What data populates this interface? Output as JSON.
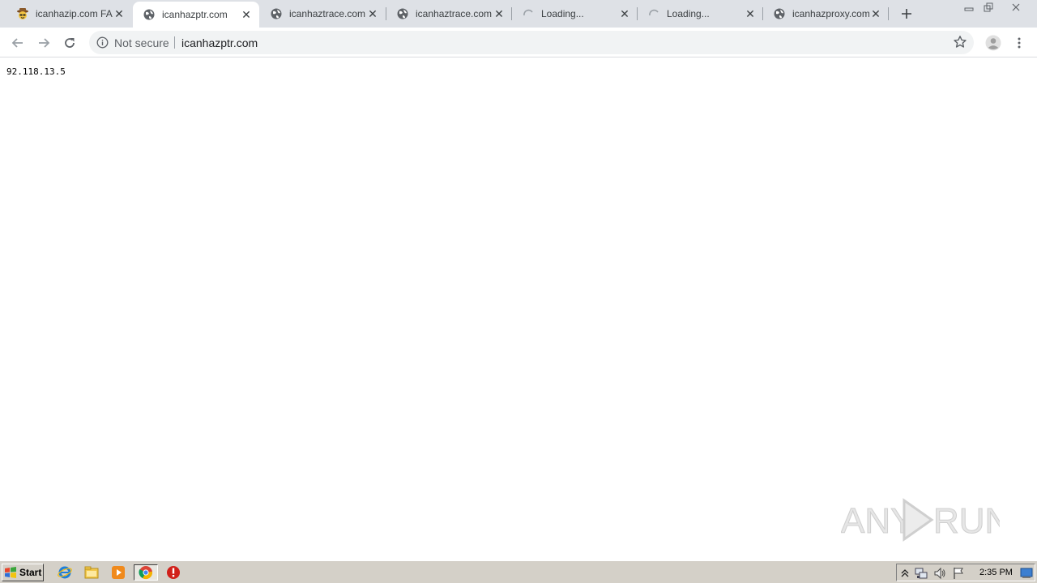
{
  "browser": {
    "tabs": [
      {
        "title": "icanhazip.com FAQ",
        "favicon": "hat-face-icon",
        "state": "loaded",
        "active": false
      },
      {
        "title": "icanhazptr.com",
        "favicon": "globe-icon",
        "state": "loaded",
        "active": true
      },
      {
        "title": "icanhaztrace.com",
        "favicon": "globe-icon",
        "state": "loaded",
        "active": false
      },
      {
        "title": "icanhaztrace.com",
        "favicon": "globe-icon",
        "state": "loaded",
        "active": false
      },
      {
        "title": "Loading...",
        "favicon": "spinner-icon",
        "state": "loading",
        "active": false
      },
      {
        "title": "Loading...",
        "favicon": "spinner-icon",
        "state": "loading",
        "active": false
      },
      {
        "title": "icanhazproxy.com",
        "favicon": "globe-icon",
        "state": "loaded",
        "active": false
      }
    ],
    "omnibox": {
      "security_label": "Not secure",
      "url": "icanhazptr.com"
    }
  },
  "page": {
    "ip_address": "92.118.13.5"
  },
  "watermark": {
    "text": "ANY RUN"
  },
  "taskbar": {
    "start_label": "Start",
    "clock": "2:35 PM"
  },
  "colors": {
    "tabstrip_bg": "#dee1e6",
    "taskbar_bg": "#d4d0c8",
    "omnibox_bg": "#f1f3f4"
  }
}
